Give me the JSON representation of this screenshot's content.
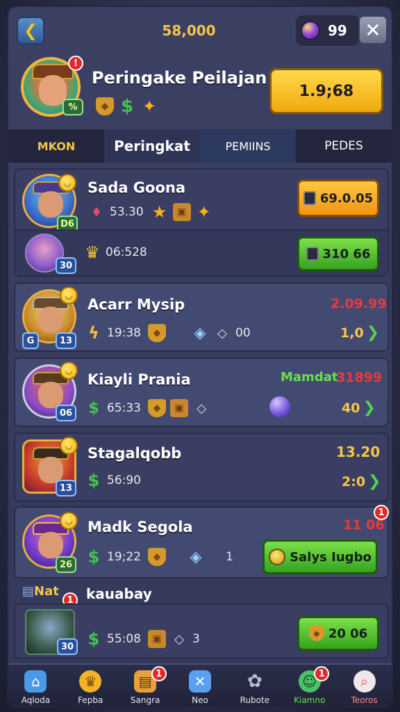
{
  "topbar": {
    "coins": "58,000",
    "gems": "99"
  },
  "profile": {
    "title": "Peringake Peilajan",
    "level": "%",
    "notify": "!",
    "primary_button": "1.9;68"
  },
  "tabs": [
    {
      "label": "MKON"
    },
    {
      "label": "Peringkat"
    },
    {
      "label": "PEMIINS"
    },
    {
      "label": "PEDES"
    }
  ],
  "rows": [
    {
      "name": "Sada Goona",
      "level": "D6",
      "stat1": "53.30",
      "button": "69.0.05",
      "sub_level": "30",
      "sub_value": "06:528",
      "sub_button": "310 66"
    },
    {
      "name": "Acarr Mysip",
      "level_left": "G",
      "level": "13",
      "stat1": "19:38",
      "stat2": "00",
      "right_value": "2.09.99",
      "arrow_value": "1,0"
    },
    {
      "name": "Kiayli Prania",
      "level": "06",
      "stat1": "65:33",
      "right_green": "Mamdat",
      "right_value": "31899",
      "arrow_value": "40"
    },
    {
      "name": "Stagalqobb",
      "level": "13",
      "stat1": "56:90",
      "right_value": "13.20",
      "arrow_value": "2:0"
    },
    {
      "name": "Madk Segola",
      "level": "26",
      "stat1": "19;22",
      "stat2": "1",
      "right_value": "11 06",
      "notify": "1",
      "button": "Salys Iugbo"
    }
  ],
  "news": {
    "tag": "Nat",
    "name": "kauabay",
    "notify": "1",
    "level": "30",
    "stat1": "55:08",
    "stat2": "3",
    "button": "20 06"
  },
  "bottom_nav": [
    {
      "label": "Aqloda",
      "icon": "home-icon",
      "color": "#4a9ae8"
    },
    {
      "label": "Fepba",
      "icon": "trophy-icon",
      "color": "#f0b32a"
    },
    {
      "label": "Sangra",
      "icon": "scroll-icon",
      "color": "#e8a03a",
      "badge": "1"
    },
    {
      "label": "Neo",
      "icon": "swords-icon",
      "color": "#5aa0f0"
    },
    {
      "label": "Rubote",
      "icon": "gear-icon",
      "color": "#8a90a8"
    },
    {
      "label": "Kiamno",
      "icon": "friends-icon",
      "color": "#4ac06a",
      "badge": "1"
    },
    {
      "label": "Teoros",
      "icon": "search-icon",
      "color": "#e84a5a"
    }
  ]
}
